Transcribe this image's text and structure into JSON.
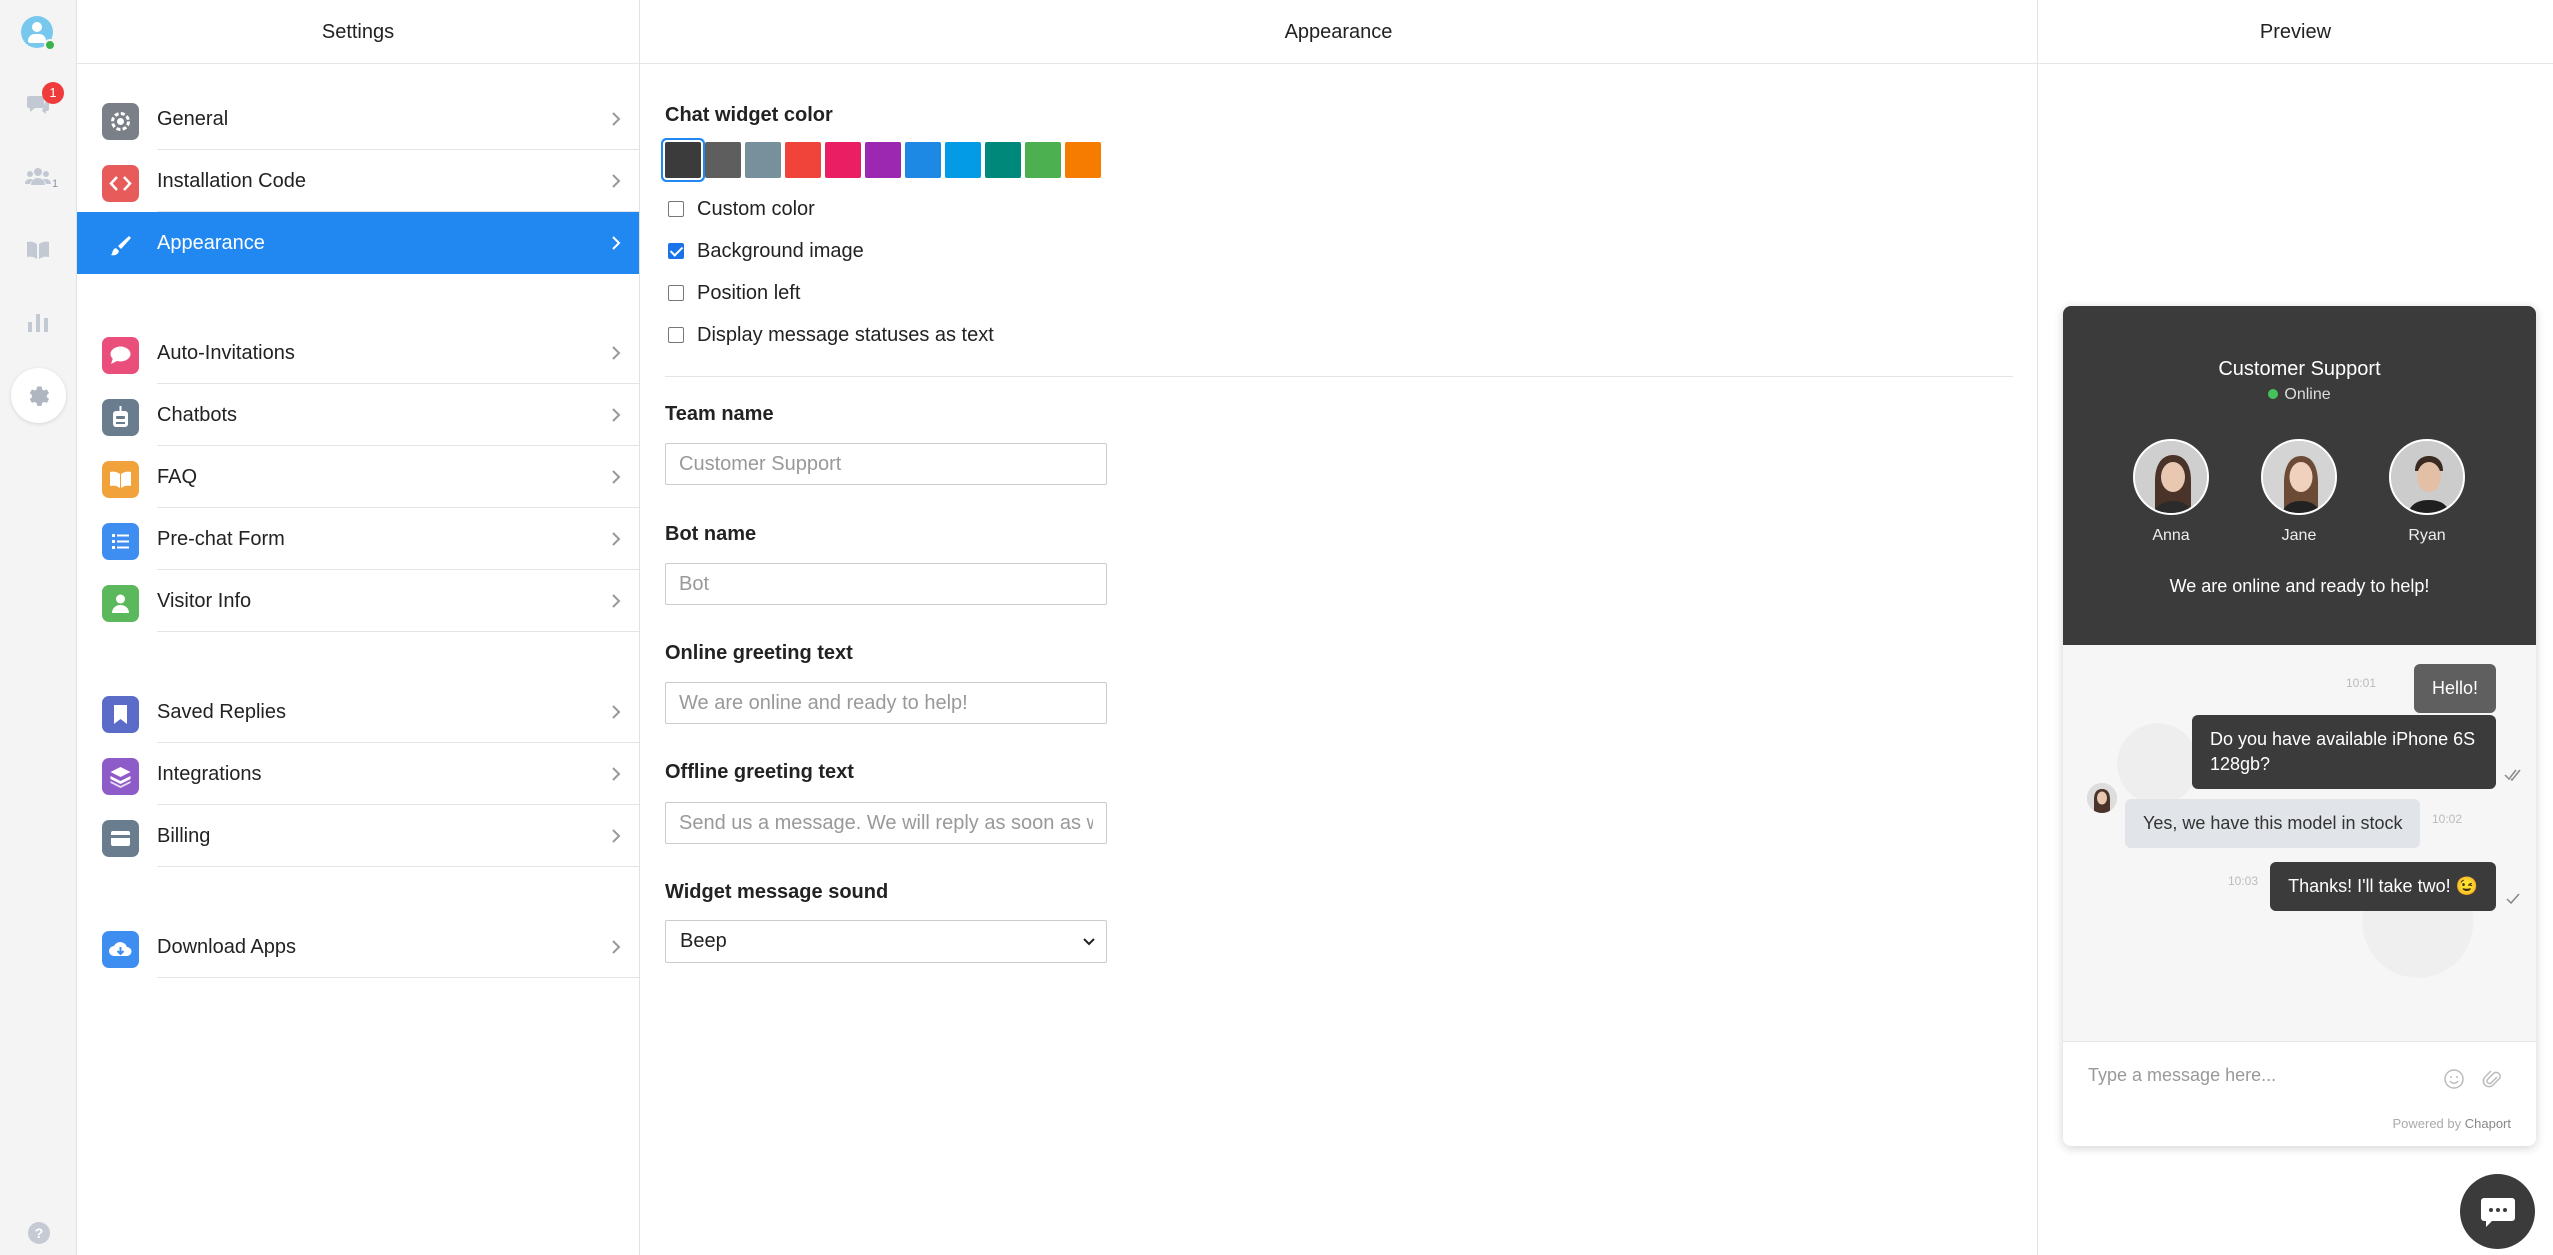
{
  "rail": {
    "badge": "1",
    "team_count": "1",
    "help": "?"
  },
  "settings": {
    "header": "Settings",
    "items": [
      {
        "label": "General",
        "color": "#7b7f87"
      },
      {
        "label": "Installation Code",
        "color": "#e85b5b"
      },
      {
        "label": "Appearance",
        "color": "#2088f0"
      },
      {
        "label": "Auto-Invitations",
        "color": "#ea4f7b"
      },
      {
        "label": "Chatbots",
        "color": "#6a7d8e"
      },
      {
        "label": "FAQ",
        "color": "#f2a23a"
      },
      {
        "label": "Pre-chat Form",
        "color": "#3d8ef0"
      },
      {
        "label": "Visitor Info",
        "color": "#5cb85c"
      },
      {
        "label": "Saved Replies",
        "color": "#5b6bc8"
      },
      {
        "label": "Integrations",
        "color": "#8e5cc8"
      },
      {
        "label": "Billing",
        "color": "#6a7d8e"
      },
      {
        "label": "Download Apps",
        "color": "#3d8ef0"
      }
    ]
  },
  "appearance": {
    "header": "Appearance",
    "chat_widget_color_label": "Chat widget color",
    "swatches": [
      "#3b3b3b",
      "#5e5e5e",
      "#78909c",
      "#f0433a",
      "#e91e63",
      "#9c27b0",
      "#1e88e5",
      "#039be5",
      "#00897b",
      "#4caf50",
      "#f57c00"
    ],
    "selected_swatch": 0,
    "checkboxes": [
      {
        "label": "Custom color",
        "checked": false
      },
      {
        "label": "Background image",
        "checked": true
      },
      {
        "label": "Position left",
        "checked": false
      },
      {
        "label": "Display message statuses as text",
        "checked": false
      }
    ],
    "team_name_label": "Team name",
    "team_name_placeholder": "Customer Support",
    "bot_name_label": "Bot name",
    "bot_name_placeholder": "Bot",
    "online_greeting_label": "Online greeting text",
    "online_greeting_placeholder": "We are online and ready to help!",
    "offline_greeting_label": "Offline greeting text",
    "offline_greeting_placeholder": "Send us a message. We will reply as soon as w",
    "sound_label": "Widget message sound",
    "sound_value": "Beep"
  },
  "preview": {
    "header": "Preview",
    "widget_title": "Customer Support",
    "widget_status": "Online",
    "agents": [
      "Anna",
      "Jane",
      "Ryan"
    ],
    "tagline": "We are online and ready to help!",
    "messages": [
      {
        "text": "Hello!",
        "time": "10:01"
      },
      {
        "text": "Do you have available iPhone 6S 128gb?",
        "time": ""
      },
      {
        "text": "Yes, we have this model in stock",
        "time": "10:02"
      },
      {
        "text": "Thanks! I'll take two! 😉",
        "time": "10:03"
      }
    ],
    "input_placeholder": "Type a message here...",
    "powered_prefix": "Powered by",
    "powered_brand": "Chaport"
  }
}
